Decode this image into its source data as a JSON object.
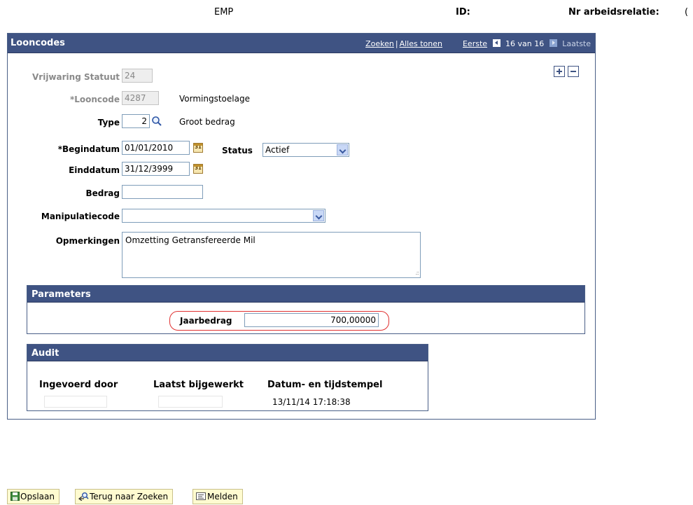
{
  "top": {
    "emp": "EMP",
    "id_label": "ID:",
    "nr_label": "Nr arbeidsrelatie:",
    "nr_value": "("
  },
  "panel": {
    "title": "Looncodes",
    "nav": {
      "zoeken": "Zoeken",
      "separator": "|",
      "alles_tonen": "Alles tonen",
      "eerste": "Eerste",
      "counter": "16 van 16",
      "laatste": "Laatste"
    }
  },
  "form": {
    "vrijwaring_label": "Vrijwaring Statuut",
    "vrijwaring_value": "24",
    "looncode_label": "*Looncode",
    "looncode_value": "4287",
    "looncode_desc": "Vormingstoelage",
    "type_label": "Type",
    "type_value": "2",
    "type_desc": "Groot bedrag",
    "begindatum_label": "*Begindatum",
    "begindatum_value": "01/01/2010",
    "status_label": "Status",
    "status_value": "Actief",
    "einddatum_label": "Einddatum",
    "einddatum_value": "31/12/3999",
    "bedrag_label": "Bedrag",
    "bedrag_value": "",
    "manipulatiecode_label": "Manipulatiecode",
    "manipulatiecode_value": "",
    "opmerkingen_label": "Opmerkingen",
    "opmerkingen_value": "Omzetting Getransfereerde Mil",
    "calendar_glyph": "31"
  },
  "parameters": {
    "title": "Parameters",
    "jaarbedrag_label": "Jaarbedrag",
    "jaarbedrag_value": "700,00000"
  },
  "audit": {
    "title": "Audit",
    "ingevoerd_door": "Ingevoerd door",
    "laatst_bijgewerkt": "Laatst bijgewerkt",
    "datum_tijdstempel": "Datum- en tijdstempel",
    "timestamp": "13/11/14 17:18:38"
  },
  "buttons": {
    "opslaan": "Opslaan",
    "terug": "Terug naar Zoeken",
    "melden": "Melden"
  },
  "colors": {
    "header_bg": "#3f5383",
    "highlight": "#e03030",
    "button_bg": "#fffbd0"
  }
}
